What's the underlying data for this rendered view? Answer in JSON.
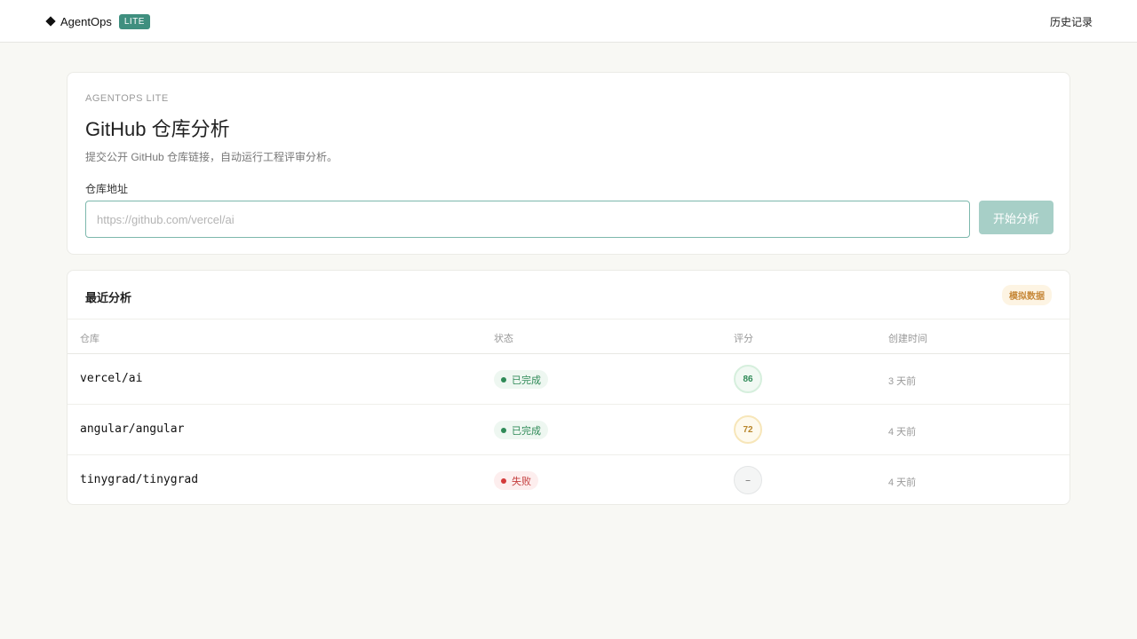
{
  "header": {
    "brand_name": "AgentOps",
    "brand_badge": "LITE",
    "history_link": "历史记录"
  },
  "form": {
    "eyebrow": "AGENTOPS LITE",
    "title": "GitHub 仓库分析",
    "description": "提交公开 GitHub 仓库链接，自动运行工程评审分析。",
    "field_label": "仓库地址",
    "input_placeholder": "https://github.com/vercel/ai",
    "input_value": "",
    "submit_label": "开始分析"
  },
  "recent": {
    "title": "最近分析",
    "badge": "模拟数据",
    "columns": {
      "repo": "仓库",
      "status": "状态",
      "score": "评分",
      "created": "创建时间"
    },
    "rows": [
      {
        "repo": "vercel/ai",
        "status": "已完成",
        "status_kind": "success",
        "score": "86",
        "score_level": "high",
        "created": "3 天前"
      },
      {
        "repo": "angular/angular",
        "status": "已完成",
        "status_kind": "success",
        "score": "72",
        "score_level": "mid",
        "created": "4 天前"
      },
      {
        "repo": "tinygrad/tinygrad",
        "status": "失败",
        "status_kind": "failed",
        "score": "–",
        "score_level": "none",
        "created": "4 天前"
      }
    ]
  },
  "colors": {
    "accent": "#3f8f7f",
    "button_disabled": "#a7cfc7",
    "success": "#2f8a57",
    "failure": "#c43d3d",
    "warning": "#c7893a"
  }
}
